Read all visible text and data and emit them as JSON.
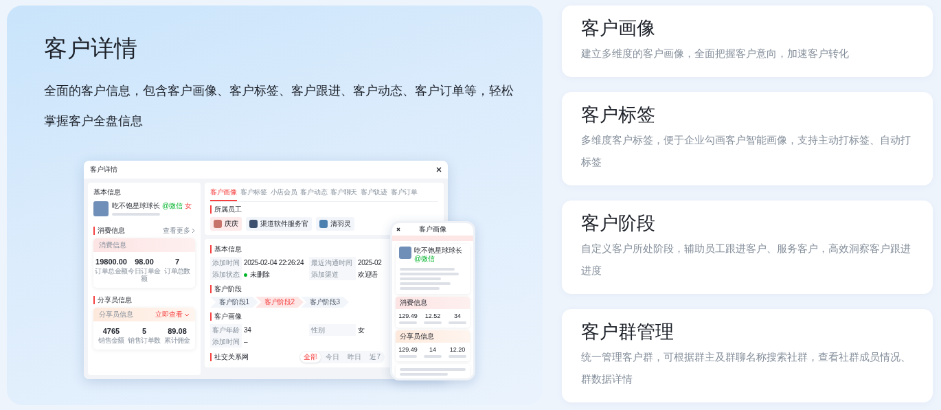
{
  "hero": {
    "title": "客户详情",
    "description": "全面的客户信息，包含客户画像、客户标签、客户跟进、客户动态、客户订单等，轻松掌握客户全盘信息"
  },
  "mockup": {
    "window_title": "客户详情",
    "basic_info": {
      "heading": "基本信息",
      "name": "吃不饱星球球长",
      "channel": "@微信",
      "gender": "女"
    },
    "consumption": {
      "heading": "消费信息",
      "more": "查看更多",
      "card_title": "消费信息",
      "metrics": [
        {
          "value": "19800.00",
          "label": "订单总金额"
        },
        {
          "value": "98.00",
          "label": "今日订单金额"
        },
        {
          "value": "7",
          "label": "订单总数"
        }
      ]
    },
    "sharer": {
      "heading": "分享员信息",
      "card_title": "分享员信息",
      "action": "立即查看",
      "metrics": [
        {
          "value": "4765",
          "label": "销售金额"
        },
        {
          "value": "5",
          "label": "销售订单数"
        },
        {
          "value": "89.08",
          "label": "累计佣金"
        }
      ]
    },
    "tabs": [
      {
        "label": "客户画像",
        "selected": true
      },
      {
        "label": "客户标签",
        "selected": false
      },
      {
        "label": "小店会员",
        "selected": false
      },
      {
        "label": "客户动态",
        "selected": false
      },
      {
        "label": "客户聊天",
        "selected": false
      },
      {
        "label": "客户轨迹",
        "selected": false
      },
      {
        "label": "客户订单",
        "selected": false
      }
    ],
    "staff": {
      "heading": "所属员工",
      "members": [
        {
          "name": "庆庆",
          "selected": true
        },
        {
          "name": "渠道软件服务官",
          "selected": false
        },
        {
          "name": "清羽灵",
          "selected": false
        }
      ]
    },
    "basic": {
      "heading": "基本信息",
      "rows": [
        [
          {
            "label": "添加时间",
            "value": "2025-02-04 22:26:24",
            "kind": "text"
          },
          {
            "label": "最近沟通时间",
            "value": "2025-02",
            "kind": "text"
          }
        ],
        [
          {
            "label": "添加状态",
            "value": "未删除",
            "kind": "status"
          },
          {
            "label": "添加渠道",
            "value": "欢迎语",
            "kind": "text"
          }
        ]
      ]
    },
    "stages": {
      "heading": "客户阶段",
      "items": [
        {
          "label": "客户阶段1",
          "selected": false
        },
        {
          "label": "客户阶段2",
          "selected": true
        },
        {
          "label": "客户阶段3",
          "selected": false
        }
      ]
    },
    "portrait": {
      "heading": "客户画像",
      "rows": [
        [
          {
            "label": "客户年龄",
            "value": "34",
            "kind": "text"
          },
          {
            "label": "性别",
            "value": "女",
            "kind": "text"
          }
        ],
        [
          {
            "label": "添加时间",
            "value": "–",
            "kind": "text"
          }
        ]
      ]
    },
    "social": {
      "heading": "社交关系网",
      "filters": [
        {
          "label": "全部",
          "selected": true
        },
        {
          "label": "今日",
          "selected": false
        },
        {
          "label": "昨日",
          "selected": false
        },
        {
          "label": "近7",
          "selected": false
        }
      ]
    }
  },
  "phone": {
    "title": "客户画像",
    "name": "吃不饱星球球长",
    "channel": "@微信",
    "consumption": {
      "heading": "消费信息",
      "metrics": [
        "129.49",
        "12.52",
        "34"
      ]
    },
    "sharer": {
      "heading": "分享员信息",
      "metrics": [
        "129.49",
        "14",
        "12.20"
      ]
    }
  },
  "features": [
    {
      "title": "客户画像",
      "description": "建立多维度的客户画像，全面把握客户意向，加速客户转化"
    },
    {
      "title": "客户标签",
      "description": "多维度客户标签，便于企业勾画客户智能画像，支持主动打标签、自动打标签"
    },
    {
      "title": "客户阶段",
      "description": "自定义客户所处阶段，辅助员工跟进客户、服务客户，高效洞察客户跟进进度"
    },
    {
      "title": "客户群管理",
      "description": "统一管理客户群，可根据群主及群聊名称搜索社群，查看社群成员情况、群数据详情"
    }
  ]
}
